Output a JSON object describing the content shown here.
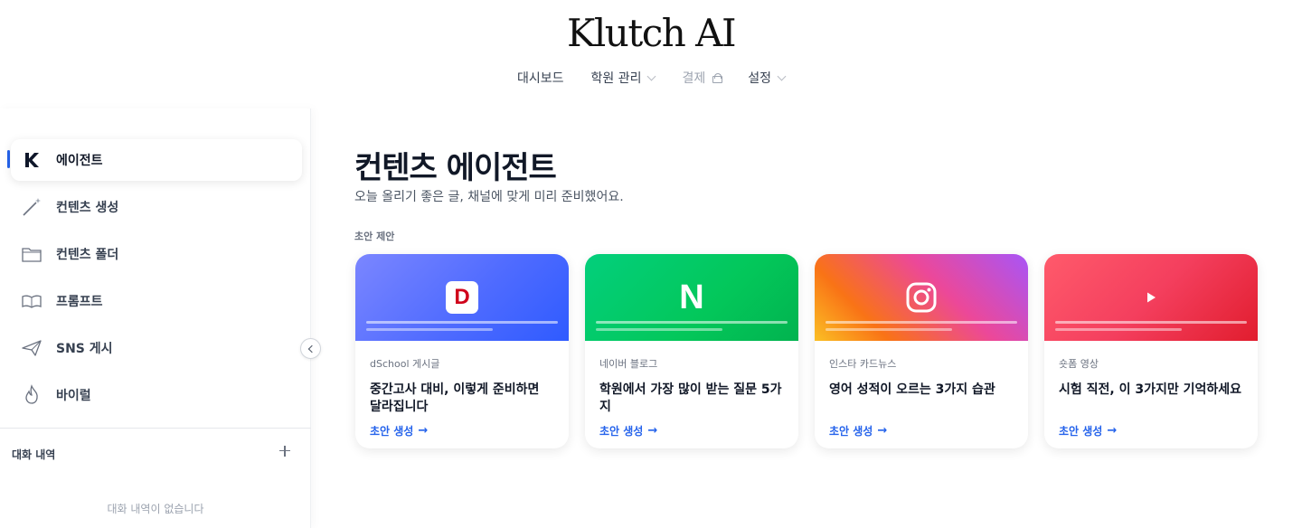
{
  "brand": "Klutch AI",
  "topnav": {
    "dashboard": "대시보드",
    "academy": "학원 관리",
    "payment": "결제",
    "settings": "설정"
  },
  "sidebar": {
    "items": [
      {
        "label": "에이전트",
        "icon": "klutch-logo-icon",
        "active": true
      },
      {
        "label": "컨텐츠 생성",
        "icon": "magic-wand-icon"
      },
      {
        "label": "컨텐츠 폴더",
        "icon": "folder-icon"
      },
      {
        "label": "프롬프트",
        "icon": "open-book-icon"
      },
      {
        "label": "SNS 게시",
        "icon": "paper-plane-icon"
      },
      {
        "label": "바이럴",
        "icon": "flame-icon"
      }
    ],
    "history_title": "대화 내역",
    "history_empty": "대화 내역이 없습니다"
  },
  "main": {
    "title": "컨텐츠 에이전트",
    "subtitle": "오늘 올리기 좋은 글, 채널에 맞게 미리 준비했어요.",
    "section_label": "초안 제안",
    "cards": [
      {
        "source": "dSchool 게시글",
        "title": "중간고사 대비, 이렇게 준비하면 달라집니다",
        "cta": "초안 생성",
        "icon": "dschool-icon",
        "color": "#4f6bff"
      },
      {
        "source": "네이버 블로그",
        "title": "학원에서 가장 많이 받는 질문 5가지",
        "cta": "초안 생성",
        "icon": "naver-icon",
        "color": "#03c75a"
      },
      {
        "source": "인스타 카드뉴스",
        "title": "영어 성적이 오르는 3가지 습관",
        "cta": "초안 생성",
        "icon": "instagram-icon",
        "color": "#ec4899"
      },
      {
        "source": "숏폼 영상",
        "title": "시험 직전, 이 3가지만 기억하세요",
        "cta": "초안 생성",
        "icon": "play-icon",
        "color": "#f43f5e"
      }
    ]
  },
  "colors": {
    "accent": "#2563eb"
  }
}
